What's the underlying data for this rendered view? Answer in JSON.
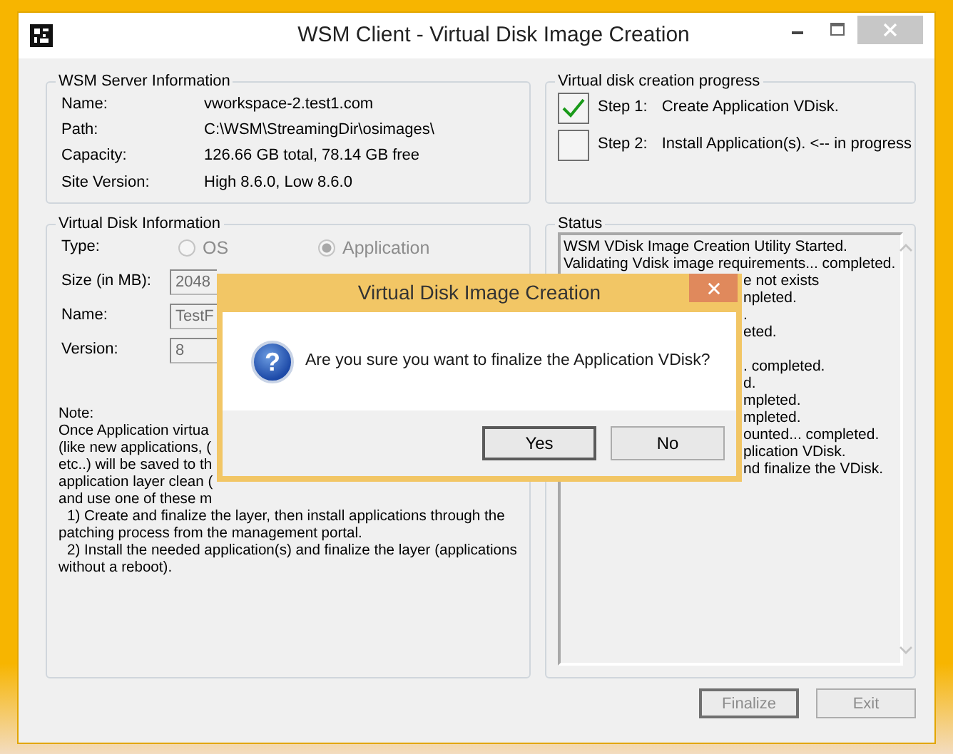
{
  "window": {
    "title": "WSM Client - Virtual Disk Image Creation"
  },
  "server_info": {
    "title": "WSM Server Information",
    "rows": [
      {
        "label": "Name:",
        "value": "vworkspace-2.test1.com"
      },
      {
        "label": "Path:",
        "value": "C:\\WSM\\StreamingDir\\osimages\\"
      },
      {
        "label": "Capacity:",
        "value": "126.66 GB total,  78.14 GB free"
      },
      {
        "label": "Site Version:",
        "value": "High 8.6.0, Low 8.6.0"
      }
    ]
  },
  "progress": {
    "title": "Virtual disk creation progress",
    "steps": [
      {
        "label": "Step 1:",
        "text": "Create Application VDisk.",
        "checked": true
      },
      {
        "label": "Step 2:",
        "text": "Install Application(s). <-- in progress",
        "checked": false
      }
    ]
  },
  "disk_info": {
    "title": "Virtual Disk Information",
    "type_label": "Type:",
    "type_options": [
      {
        "label": "OS",
        "selected": false,
        "disabled": true
      },
      {
        "label": "Application",
        "selected": true,
        "disabled": true
      }
    ],
    "fields": [
      {
        "label": "Size (in MB):",
        "value": "2048",
        "disabled": true
      },
      {
        "label": "Name:",
        "value": "TestF",
        "disabled": true
      },
      {
        "label": "Version:",
        "value": "8",
        "disabled": true
      }
    ],
    "note_lines": [
      {
        "text": "Note:",
        "indented": false
      },
      {
        "text": "Once Application virtua",
        "indented": false
      },
      {
        "text": "(like new applications, (",
        "indented": false
      },
      {
        "text": "etc..) will be saved to th",
        "indented": false
      },
      {
        "text": "application layer clean (",
        "indented": false
      },
      {
        "text": "and use one of these m",
        "indented": false
      },
      {
        "text": "1) Create and finalize the layer, then install applications through the",
        "indented": true
      },
      {
        "text": "patching process from the management portal.",
        "indented": false
      },
      {
        "text": "2) Install the needed application(s) and finalize the layer (applications",
        "indented": true
      },
      {
        "text": "without a reboot).",
        "indented": false
      }
    ]
  },
  "status": {
    "title": "Status",
    "lines": [
      {
        "kind": "text",
        "text": "WSM VDisk Image Creation Utility Started.",
        "covered": false
      },
      {
        "kind": "text",
        "text": "Validating Vdisk image requirements... completed.",
        "covered": false
      },
      {
        "kind": "text",
        "text": "e not exists",
        "covered": true
      },
      {
        "kind": "text",
        "text": "npleted.",
        "covered": true
      },
      {
        "kind": "text",
        "text": ".",
        "covered": true
      },
      {
        "kind": "text",
        "text": "eted.",
        "covered": true
      },
      {
        "kind": "blank"
      },
      {
        "kind": "text",
        "text": ". completed.",
        "covered": true
      },
      {
        "kind": "text",
        "text": "d.",
        "covered": true
      },
      {
        "kind": "text",
        "text": "mpleted.",
        "covered": true
      },
      {
        "kind": "text",
        "text": "mpleted.",
        "covered": true
      },
      {
        "kind": "text",
        "text": "ounted... completed.",
        "covered": true
      },
      {
        "kind": "text",
        "text": "plication VDisk.",
        "covered": true
      },
      {
        "kind": "text",
        "text": "nd finalize the VDisk.",
        "covered": true
      }
    ]
  },
  "buttons": [
    {
      "label": "Finalize",
      "disabled": true,
      "default": true
    },
    {
      "label": "Exit",
      "disabled": true,
      "default": false
    }
  ],
  "dialog": {
    "title": "Virtual Disk Image Creation",
    "icon": "?",
    "message": "Are you sure you want to finalize the Application VDisk?",
    "buttons": [
      "Yes",
      "No"
    ]
  }
}
